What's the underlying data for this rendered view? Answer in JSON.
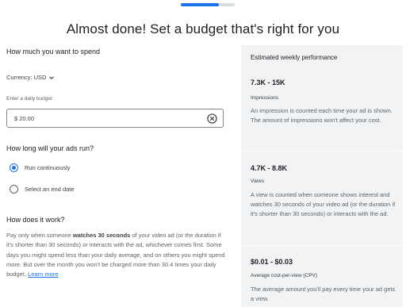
{
  "progress": {
    "fraction": 0.7
  },
  "page_title": "Almost done! Set a budget that's right for you",
  "spend": {
    "heading": "How much you want to spend",
    "currency_label": "Currency: USD",
    "budget_field_label": "Enter a daily budget",
    "budget_value": "$ 20.00"
  },
  "duration": {
    "heading": "How long will your ads run?",
    "options": [
      {
        "label": "Run continuously",
        "selected": true
      },
      {
        "label": "Select an end date",
        "selected": false
      }
    ]
  },
  "how": {
    "heading": "How does it work?",
    "text_1": "Pay only when someone ",
    "text_bold": "watches 30 seconds",
    "text_2": " of your video ad (or the duration if it's shorter than 30 seconds) or interacts with the ad, whichever comes first. Some days you might spend less than your daily average, and on others you might spend more. But over the month you won't be charged more than 30.4 times your daily budget. ",
    "link": "Learn more"
  },
  "performance": {
    "heading": "Estimated weekly performance",
    "metrics": [
      {
        "value": "7.3K - 15K",
        "label": "Impressions",
        "description": "An impression is counted each time your ad is shown. The amount of impressions won't affect your cost."
      },
      {
        "value": "4.7K - 8.8K",
        "label": "Views",
        "description": "A view is counted when someone shows interest and watches 30 seconds of your video ad (or the duration if it's shorter than 30 seconds) or interacts with the ad."
      },
      {
        "value": "$0.01 - $0.03",
        "label": "Average cost-per-view (CPV)",
        "description": "The average amount you'll pay every time your ad gets a view."
      }
    ]
  },
  "colors": {
    "accent": "#1a73e8",
    "panel": "#f1f3f4",
    "text": "#3c4043"
  },
  "icons": {
    "currency_toggle": "chevron-down-icon",
    "clear": "clear-circle-icon"
  }
}
